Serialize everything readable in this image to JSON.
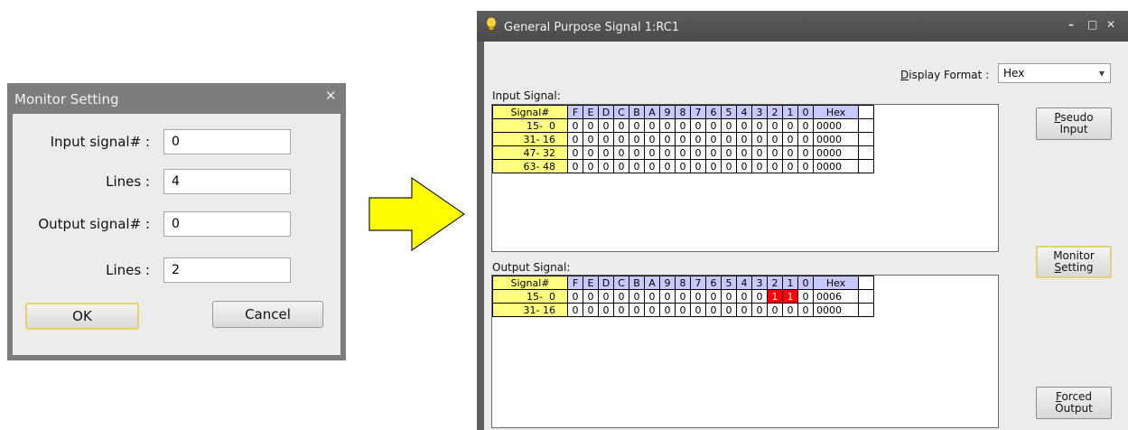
{
  "dialog": {
    "title": "Monitor Setting",
    "close_glyph": "✕",
    "fields": [
      {
        "label": "Input signal# :",
        "value": "0"
      },
      {
        "label": "Lines :",
        "value": "4"
      },
      {
        "label": "Output signal# :",
        "value": "0"
      },
      {
        "label": "Lines :",
        "value": "2"
      }
    ],
    "ok_label": "OK",
    "cancel_label": "Cancel"
  },
  "arrow": {
    "color": "#ffff00",
    "icon": "right-arrow-icon"
  },
  "window": {
    "title": "General Purpose Signal 1:RC1",
    "icon": "lightbulb-icon",
    "controls": {
      "minimize": "–",
      "maximize": "□",
      "close": "✕"
    },
    "display_format": {
      "label_first": "D",
      "label_rest": "isplay Format :",
      "value": "Hex"
    },
    "input_label": "Input Signal:",
    "output_label": "Output Signal:",
    "header": {
      "signal": "Signal#",
      "bits": [
        "F",
        "E",
        "D",
        "C",
        "B",
        "A",
        "9",
        "8",
        "7",
        "6",
        "5",
        "4",
        "3",
        "2",
        "1",
        "0"
      ],
      "hex": "Hex"
    },
    "input_rows": [
      {
        "label": "15-  0",
        "bits": [
          "0",
          "0",
          "0",
          "0",
          "0",
          "0",
          "0",
          "0",
          "0",
          "0",
          "0",
          "0",
          "0",
          "0",
          "0",
          "0"
        ],
        "hex": "0000"
      },
      {
        "label": "31- 16",
        "bits": [
          "0",
          "0",
          "0",
          "0",
          "0",
          "0",
          "0",
          "0",
          "0",
          "0",
          "0",
          "0",
          "0",
          "0",
          "0",
          "0"
        ],
        "hex": "0000"
      },
      {
        "label": "47- 32",
        "bits": [
          "0",
          "0",
          "0",
          "0",
          "0",
          "0",
          "0",
          "0",
          "0",
          "0",
          "0",
          "0",
          "0",
          "0",
          "0",
          "0"
        ],
        "hex": "0000"
      },
      {
        "label": "63- 48",
        "bits": [
          "0",
          "0",
          "0",
          "0",
          "0",
          "0",
          "0",
          "0",
          "0",
          "0",
          "0",
          "0",
          "0",
          "0",
          "0",
          "0"
        ],
        "hex": "0000"
      }
    ],
    "output_rows": [
      {
        "label": "15-  0",
        "bits": [
          "0",
          "0",
          "0",
          "0",
          "0",
          "0",
          "0",
          "0",
          "0",
          "0",
          "0",
          "0",
          "0",
          "1",
          "1",
          "0"
        ],
        "hex": "0006"
      },
      {
        "label": "31- 16",
        "bits": [
          "0",
          "0",
          "0",
          "0",
          "0",
          "0",
          "0",
          "0",
          "0",
          "0",
          "0",
          "0",
          "0",
          "0",
          "0",
          "0"
        ],
        "hex": "0000"
      }
    ],
    "buttons": {
      "pseudo": {
        "first": "P",
        "rest": "seudo",
        "line2": "Input"
      },
      "monitor": {
        "line1": "Monitor",
        "first": "S",
        "rest": "etting"
      },
      "forced": {
        "first": "F",
        "rest": "orced",
        "line2": "Output"
      }
    },
    "colors": {
      "row_label": "#ffff80",
      "header": "#c8c8ff",
      "bit_on": "#ff0000"
    }
  }
}
